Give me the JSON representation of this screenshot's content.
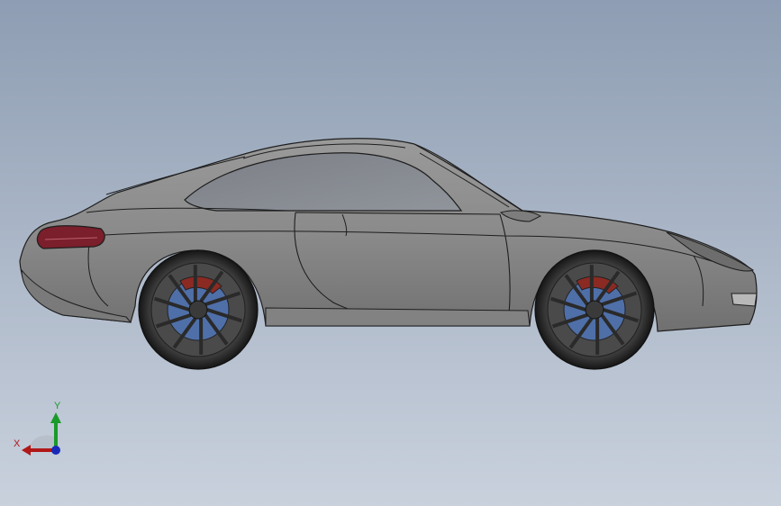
{
  "viewport": {
    "background_top": "#8e9db3",
    "background_bottom": "#c9d1dd"
  },
  "model": {
    "body_color": "#8c8c8c",
    "body_shade_color": "#6f6f6f",
    "edge_color": "#1e1e1e",
    "taillight_color": "#7a1f2b",
    "brake_disc_color": "#4f6fa8",
    "caliper_color": "#8a2a22",
    "wheel_spoke_color": "#2a2a2a"
  },
  "triad": {
    "x_label": "X",
    "y_label": "Y",
    "x_color": "#b01818",
    "y_color": "#1a9a2a",
    "z_color": "#1a2ab8"
  }
}
